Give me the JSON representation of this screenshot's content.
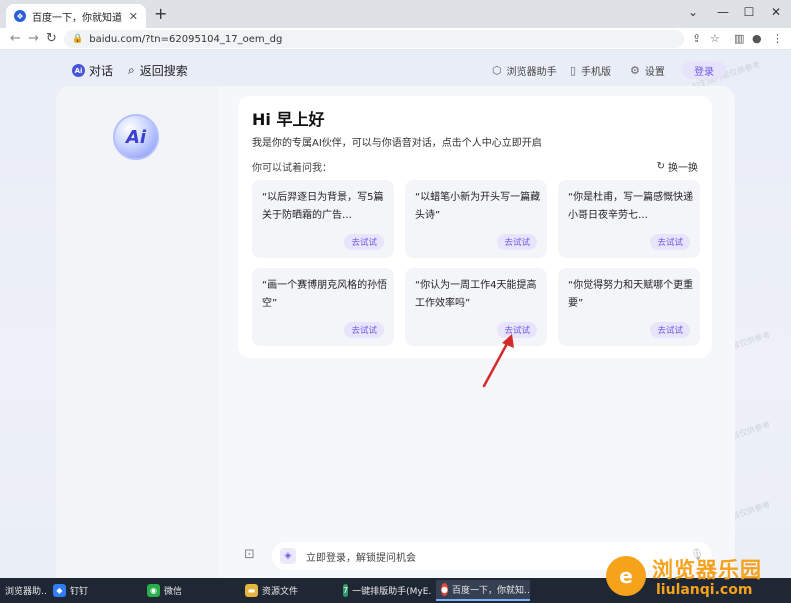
{
  "browser": {
    "tab_title": "百度一下，你就知道",
    "new_tab": "+",
    "window_controls": [
      "⌄",
      "—",
      "☐",
      "✕"
    ],
    "url": "baidu.com/?tn=62095104_17_oem_dg"
  },
  "topnav": {
    "brand_label": "对话",
    "back_label": "返回搜索",
    "browser_assistant": "浏览器助手",
    "mobile": "手机版",
    "settings": "设置",
    "login": "登录"
  },
  "card": {
    "greeting": "Hi 早上好",
    "intro": "我是你的专属AI伙伴，可以与你语音对话，点击个人中心立即开启",
    "try_ask": "你可以试着问我：",
    "refresh": "换一换",
    "suggestions": [
      {
        "text": "“以后羿逐日为背景，写5篇关于防晒霜的广告…",
        "button": "去试试"
      },
      {
        "text": "“以蜡笔小新为开头写一篇藏头诗”",
        "button": "去试试"
      },
      {
        "text": "“你是杜甫，写一篇感慨快递小哥日夜辛劳七…",
        "button": "去试试"
      },
      {
        "text": "“画一个赛博朋克风格的孙悟空”",
        "button": "去试试"
      },
      {
        "text": "“你认为一周工作4天能提高工作效率吗”",
        "button": "去试试"
      },
      {
        "text": "“你觉得努力和天赋哪个更重要”",
        "button": "去试试"
      }
    ]
  },
  "input": {
    "placeholder": "立即登录，解锁提问机会"
  },
  "watermark": "AI生成内容仅供参考",
  "taskbar": {
    "items": [
      {
        "label": "浏览器助…",
        "color": "#3d7bd9"
      },
      {
        "label": "钉钉",
        "color": "#2f7cf6"
      },
      {
        "label": "微信",
        "color": "#2aae4c"
      },
      {
        "label": "资源文件",
        "color": "#e4b540"
      },
      {
        "label": "一键排版助手(MyE…",
        "color": "#2d9a6a"
      },
      {
        "label": "百度一下，你就知…",
        "color": "#e24a3b"
      }
    ]
  },
  "site_logo": {
    "cn": "浏览器乐园",
    "en": "liulanqi.com"
  },
  "colors": {
    "accent": "#6b5be6",
    "arrow": "#d42a2a",
    "logo_orange": "#f6a21b"
  }
}
